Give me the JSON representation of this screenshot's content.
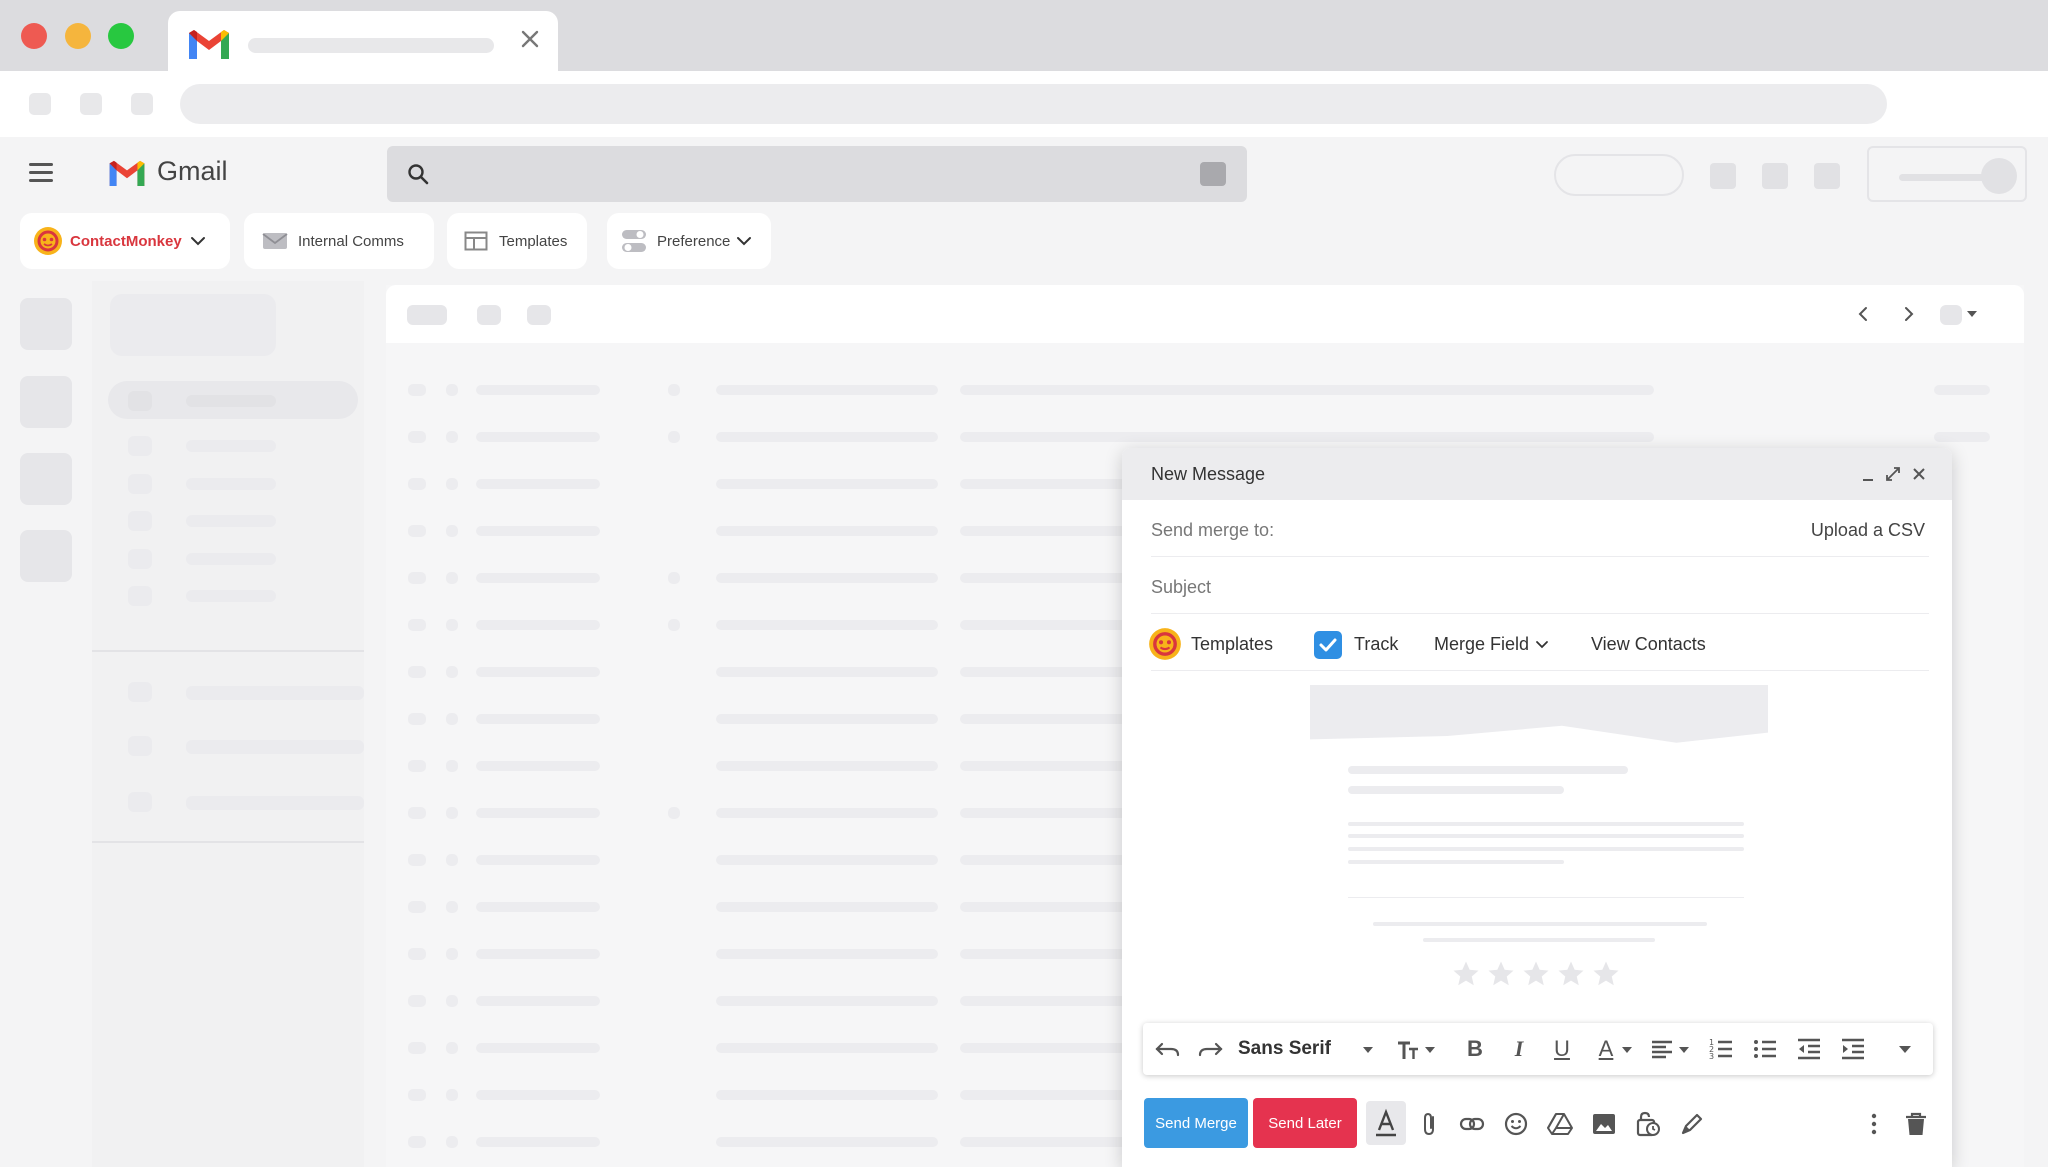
{
  "browser": {
    "tab_title": "",
    "url": ""
  },
  "gmail": {
    "app_name": "Gmail",
    "search_placeholder": ""
  },
  "extension_bar": {
    "contactmonkey_label": "ContactMonkey",
    "internal_comms_label": "Internal Comms",
    "templates_label": "Templates",
    "preference_label": "Preference"
  },
  "compose": {
    "title": "New Message",
    "send_merge_to_label": "Send merge to:",
    "upload_csv_label": "Upload a CSV",
    "subject_label": "Subject",
    "toolbar": {
      "templates_label": "Templates",
      "track_label": "Track",
      "track_checked": true,
      "merge_field_label": "Merge Field",
      "view_contacts_label": "View Contacts"
    },
    "preview": {
      "rating_stars": 5
    },
    "format": {
      "font_name": "Sans Serif"
    },
    "actions": {
      "send_merge_label": "Send Merge",
      "send_later_label": "Send Later"
    }
  },
  "colors": {
    "primary_blue": "#3b9ae1",
    "send_later_red": "#e5334f",
    "contactmonkey_red": "#d9363e",
    "checkbox_blue": "#2f8fe3",
    "traffic_red": "#ee5a52",
    "traffic_yellow": "#f5b53d",
    "traffic_green": "#28c840"
  }
}
